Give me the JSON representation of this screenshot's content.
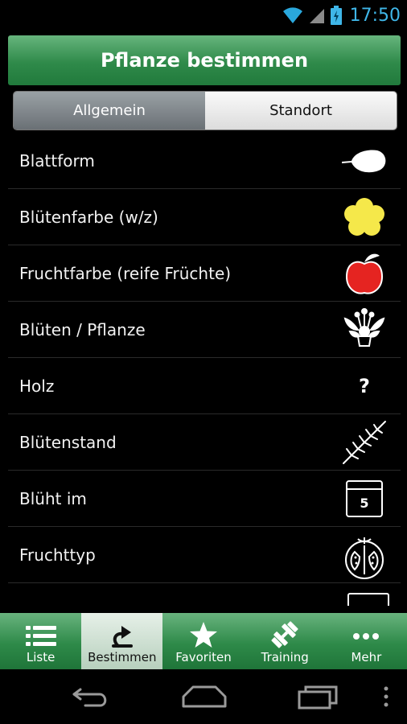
{
  "status": {
    "time": "17:50"
  },
  "header": {
    "title": "Pflanze bestimmen"
  },
  "tabs": {
    "general": "Allgemein",
    "location": "Standort"
  },
  "rows": [
    {
      "label": "Blattform",
      "icon": "leaf-icon"
    },
    {
      "label": "Blütenfarbe (w/z)",
      "icon": "yellow-flower-icon"
    },
    {
      "label": "Fruchtfarbe (reife Früchte)",
      "icon": "red-apple-icon"
    },
    {
      "label": "Blüten / Pflanze",
      "icon": "flower-diagram-icon"
    },
    {
      "label": "Holz",
      "icon": "question-icon"
    },
    {
      "label": "Blütenstand",
      "icon": "branch-icon"
    },
    {
      "label": "Blüht im",
      "icon": "calendar-icon"
    },
    {
      "label": "Fruchttyp",
      "icon": "fruit-section-icon"
    }
  ],
  "calendar_day": "5",
  "holz_symbol": "?",
  "bottom_tabs": [
    {
      "label": "Liste",
      "icon": "list-icon"
    },
    {
      "label": "Bestimmen",
      "icon": "identify-icon",
      "active": true
    },
    {
      "label": "Favoriten",
      "icon": "star-icon"
    },
    {
      "label": "Training",
      "icon": "dumbbell-icon"
    },
    {
      "label": "Mehr",
      "icon": "more-icon"
    }
  ],
  "colors": {
    "accent_green": "#2f8a4a",
    "status_blue": "#3fb6e8",
    "flower_yellow": "#f5e84a",
    "apple_red": "#e52421"
  }
}
